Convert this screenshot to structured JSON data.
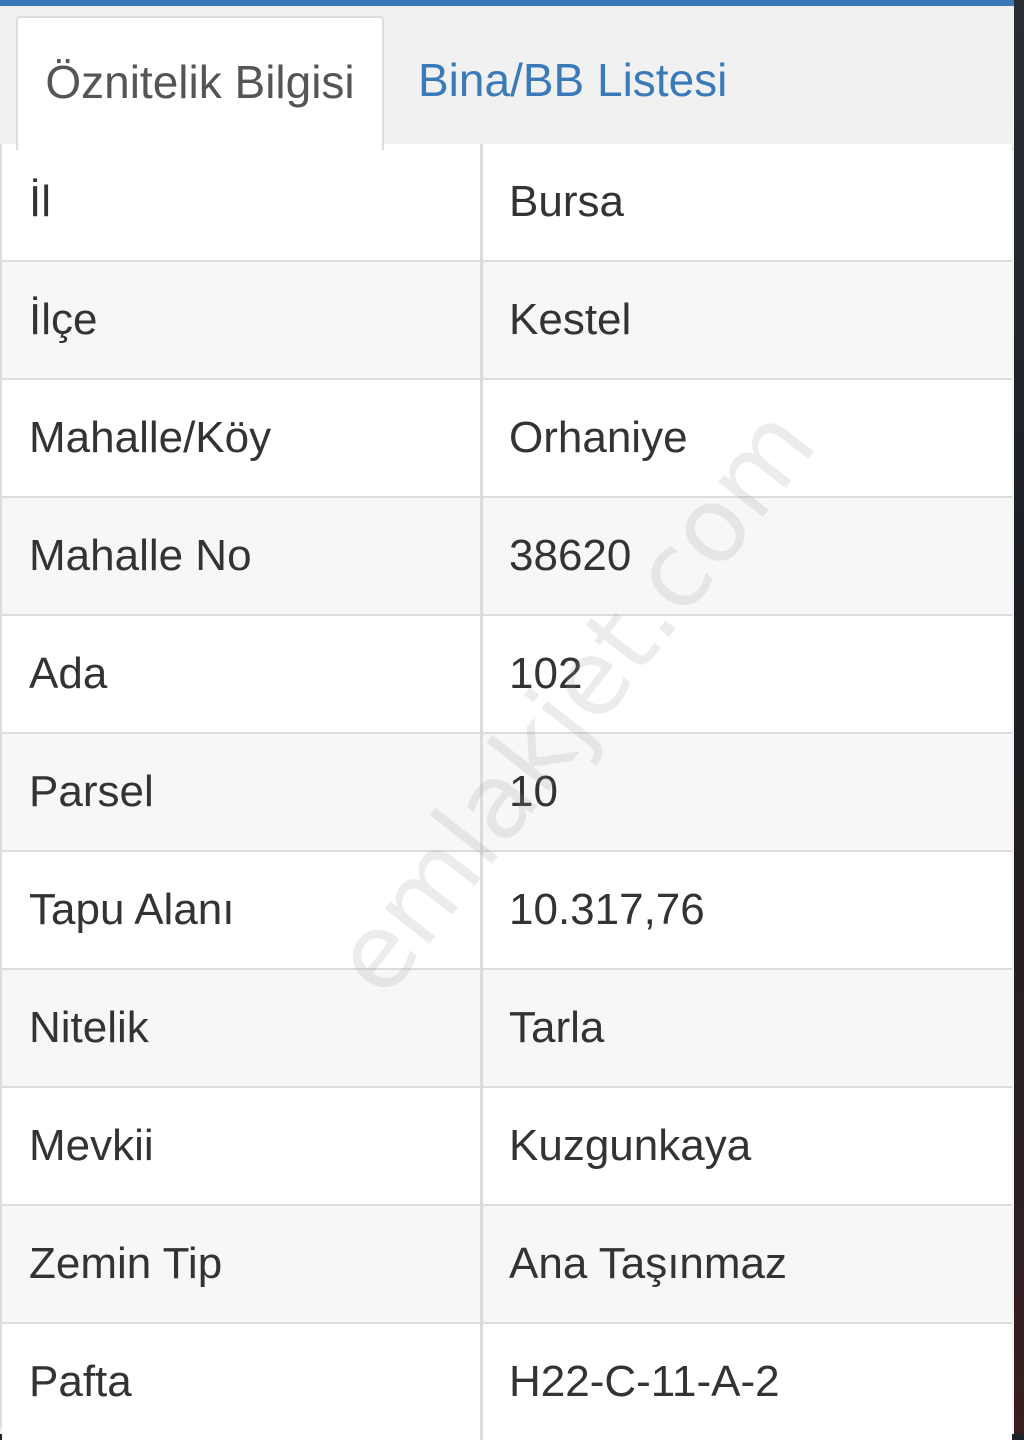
{
  "tabs": [
    {
      "label": "Öznitelik Bilgisi",
      "active": true
    },
    {
      "label": "Bina/BB Listesi",
      "active": false
    }
  ],
  "rows": [
    {
      "label": "İl",
      "value": "Bursa"
    },
    {
      "label": "İlçe",
      "value": "Kestel"
    },
    {
      "label": "Mahalle/Köy",
      "value": "Orhaniye"
    },
    {
      "label": "Mahalle No",
      "value": "38620"
    },
    {
      "label": "Ada",
      "value": "102"
    },
    {
      "label": "Parsel",
      "value": "10"
    },
    {
      "label": "Tapu Alanı",
      "value": "10.317,76"
    },
    {
      "label": "Nitelik",
      "value": "Tarla"
    },
    {
      "label": "Mevkii",
      "value": "Kuzgunkaya"
    },
    {
      "label": "Zemin Tip",
      "value": "Ana Taşınmaz"
    },
    {
      "label": "Pafta",
      "value": "H22-C-11-A-2"
    }
  ],
  "watermark": "emlakjet.com",
  "colors": {
    "accent": "#3a7ab8",
    "topbar": "#3a78b5",
    "border": "#dcdcdc",
    "text": "#333333"
  }
}
